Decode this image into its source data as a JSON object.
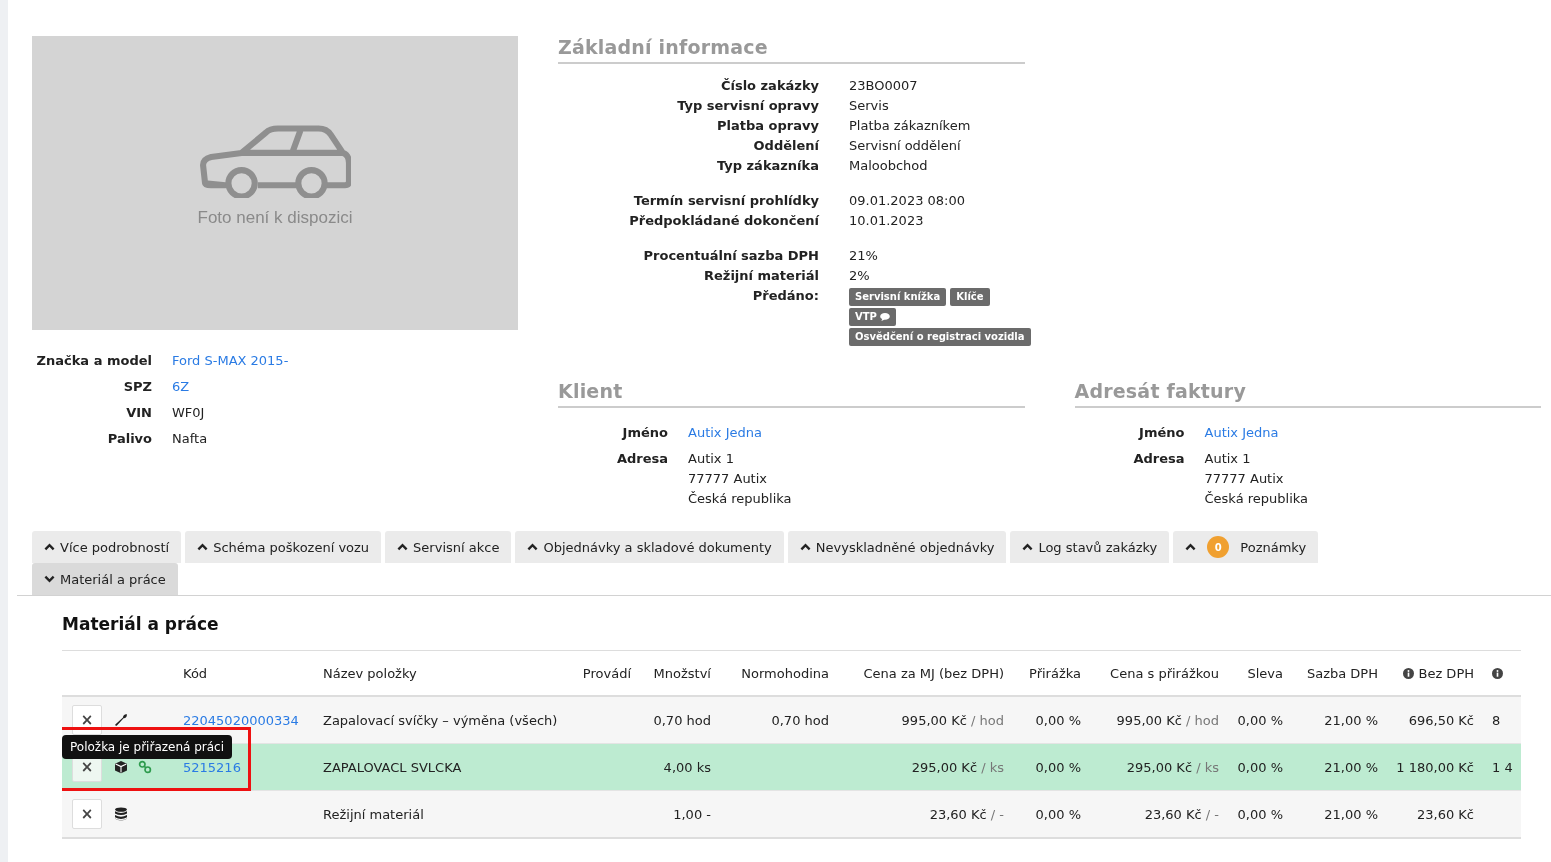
{
  "photo": {
    "caption": "Foto není k dispozici"
  },
  "vehicle": [
    {
      "label": "Značka a model",
      "value": "Ford S-MAX 2015-",
      "link": true
    },
    {
      "label": "SPZ",
      "value": "6Z",
      "link": true
    },
    {
      "label": "VIN",
      "value": "WF0J",
      "link": false
    },
    {
      "label": "Palivo",
      "value": "Nafta",
      "link": false
    }
  ],
  "basic_info": {
    "title": "Základní informace",
    "groups": [
      [
        {
          "label": "Číslo zakázky",
          "value": "23BO0007"
        },
        {
          "label": "Typ servisní opravy",
          "value": "Servis"
        },
        {
          "label": "Platba opravy",
          "value": "Platba zákazníkem"
        },
        {
          "label": "Oddělení",
          "value": "Servisní oddělení"
        },
        {
          "label": "Typ zákazníka",
          "value": "Maloobchod"
        }
      ],
      [
        {
          "label": "Termín servisní prohlídky",
          "value": "09.01.2023 08:00"
        },
        {
          "label": "Předpokládané dokončení",
          "value": "10.01.2023"
        }
      ],
      [
        {
          "label": "Procentuální sazba DPH",
          "value": "21%"
        },
        {
          "label": "Režijní materiál",
          "value": "2%"
        }
      ]
    ],
    "handed_over": {
      "label": "Předáno:",
      "tags": [
        {
          "text": "Servisní knížka",
          "comment": false
        },
        {
          "text": "Klíče",
          "comment": false
        },
        {
          "text": "VTP",
          "comment": true
        },
        {
          "text": "Osvědčení o registraci vozidla",
          "comment": false
        }
      ]
    }
  },
  "parties": [
    {
      "title": "Klient",
      "name_label": "Jméno",
      "name": "Autix Jedna",
      "address_label": "Adresa",
      "address": [
        "Autix 1",
        "77777 Autix",
        "Česká republika"
      ]
    },
    {
      "title": "Adresát faktury",
      "name_label": "Jméno",
      "name": "Autix Jedna",
      "address_label": "Adresa",
      "address": [
        "Autix 1",
        "77777 Autix",
        "Česká republika"
      ]
    }
  ],
  "tabs": [
    {
      "label": "Více podrobností",
      "expanded": false
    },
    {
      "label": "Schéma poškození vozu",
      "expanded": false
    },
    {
      "label": "Servisní akce",
      "expanded": false
    },
    {
      "label": "Objednávky a skladové dokumenty",
      "expanded": false
    },
    {
      "label": "Nevyskladněné objednávky",
      "expanded": false
    },
    {
      "label": "Log stavů zakázky",
      "expanded": false
    },
    {
      "label": "Poznámky",
      "expanded": false,
      "badge": "0"
    },
    {
      "label": "Materiál a práce",
      "expanded": true
    }
  ],
  "materials": {
    "title": "Materiál a práce",
    "columns": [
      {
        "label": "Kód",
        "info": false
      },
      {
        "label": "Název položky",
        "info": false
      },
      {
        "label": "Provádí",
        "info": false
      },
      {
        "label": "Množství",
        "info": false
      },
      {
        "label": "Normohodina",
        "info": false
      },
      {
        "label": "Cena za MJ (bez DPH)",
        "info": false
      },
      {
        "label": "Přirážka",
        "info": false
      },
      {
        "label": "Cena s přirážkou",
        "info": false
      },
      {
        "label": "Sleva",
        "info": false
      },
      {
        "label": "Sazba DPH",
        "info": false
      },
      {
        "label": "Bez DPH",
        "info": true
      },
      {
        "info": true
      }
    ],
    "rows": [
      {
        "kind": "work",
        "remove_label": "×",
        "linked": false,
        "highlighted": false,
        "code": "22045020000334",
        "name": "Zapalovací svíčky – výměna (všech)",
        "quantity": "0,70 hod",
        "standard_hours": "0,70 hod",
        "unit_price": {
          "amount": "995,00 Kč",
          "unit": "/ hod"
        },
        "markup": "0,00 %",
        "price_with_markup": {
          "amount": "995,00 Kč",
          "unit": "/ hod"
        },
        "discount": "0,00 %",
        "vat_rate": "21,00 %",
        "without_vat": "696,50 Kč",
        "column_13": "8"
      },
      {
        "kind": "material",
        "remove_label": "×",
        "linked": true,
        "highlighted": true,
        "tooltip": "Položka je přiřazená práci",
        "code": "5215216",
        "name": "ZAPALOVACL SVLCKA",
        "quantity": "4,00 ks",
        "unit_price": {
          "amount": "295,00 Kč",
          "unit": "/ ks"
        },
        "markup": "0,00 %",
        "price_with_markup": {
          "amount": "295,00 Kč",
          "unit": "/ ks"
        },
        "discount": "0,00 %",
        "vat_rate": "21,00 %",
        "without_vat": "1 180,00 Kč",
        "column_13": "1 4"
      },
      {
        "kind": "overhead",
        "remove_label": "×",
        "linked": false,
        "highlighted": false,
        "name": "Režijní materiál",
        "quantity": "1,00 -",
        "unit_price": {
          "amount": "23,60 Kč",
          "unit": "/ -"
        },
        "markup": "0,00 %",
        "price_with_markup": {
          "amount": "23,60 Kč",
          "unit": "/ -"
        },
        "discount": "0,00 %",
        "vat_rate": "21,00 %",
        "without_vat": "23,60 Kč"
      }
    ]
  }
}
